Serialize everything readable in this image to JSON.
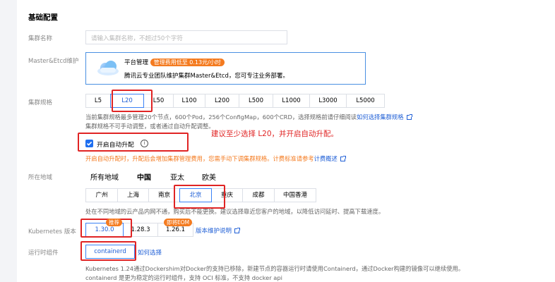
{
  "section": {
    "title": "基础配置"
  },
  "cluster_name": {
    "label": "集群名称",
    "placeholder": "请输入集群名称，不超过50个字符"
  },
  "master_etcd": {
    "label": "Master&Etcd维护",
    "option_title": "平台管理",
    "badge": "管理费用低至 0.13元/小时",
    "description": "腾讯云专业团队维护集群Master&Etcd，您可专注业务部署。",
    "icon": "cloud-icon"
  },
  "cluster_spec": {
    "label": "集群规格",
    "options": [
      "L5",
      "L20",
      "L50",
      "L100",
      "L200",
      "L500",
      "L1000",
      "L3000",
      "L5000"
    ],
    "selected": "L20",
    "hint_line1": "当前集群规格最多管理20个节点，600个Pod，256个ConfigMap，600个CRD，选择规格前请仔细阅读",
    "hint_link": "如何选择集群规格",
    "hint_line2": "集群规格不可手动调整，或者通过自动升配调整。",
    "hint_line2_link": "自动升配",
    "annotation": "建议至少选择 L20，并开启自动升配。",
    "auto_upgrade": {
      "label": "开启自动升配",
      "checked": true,
      "info_icon": "info-icon"
    },
    "warning": "开启自动升配时，升配后会增加集群管理费用，您需手动下调集群规格。计费标准请参考",
    "warning_link": "计费概述"
  },
  "region": {
    "label": "所在地域",
    "tabs": [
      "所有地域",
      "中国",
      "亚太",
      "欧美"
    ],
    "active_tab": "中国",
    "cities": [
      "广州",
      "上海",
      "南京",
      "北京",
      "重庆",
      "成都",
      "中国香港"
    ],
    "selected_city": "北京",
    "hint": "处在不同地域的云产品内网不通，购买后不能更换。建议选择靠近您客户的地域，以降低访问延时、提高下载速度。"
  },
  "k8s_version": {
    "label": "Kubernetes 版本",
    "versions": [
      "1.30.0",
      "1.28.3",
      "1.26.1"
    ],
    "selected": "1.30.0",
    "recommend_tag": "推荐",
    "eom_tag": "即将EOM",
    "link": "版本维护说明"
  },
  "runtime": {
    "label": "运行时组件",
    "option": "containerd",
    "link": "如何选择",
    "hint_line1": "Kubernetes 1.24通过Dockershim对Docker的支持已移除，新建节点的容器运行时请使用Containerd，通过Docker构建的镜像可以继续使用。",
    "hint_line2": "containerd 是更为稳定的运行时组件，支持 OCI 标准，不支持 docker api"
  },
  "colors": {
    "accent": "#1f5fd6",
    "orange": "#f47b20",
    "annotation_red": "#e02424"
  }
}
